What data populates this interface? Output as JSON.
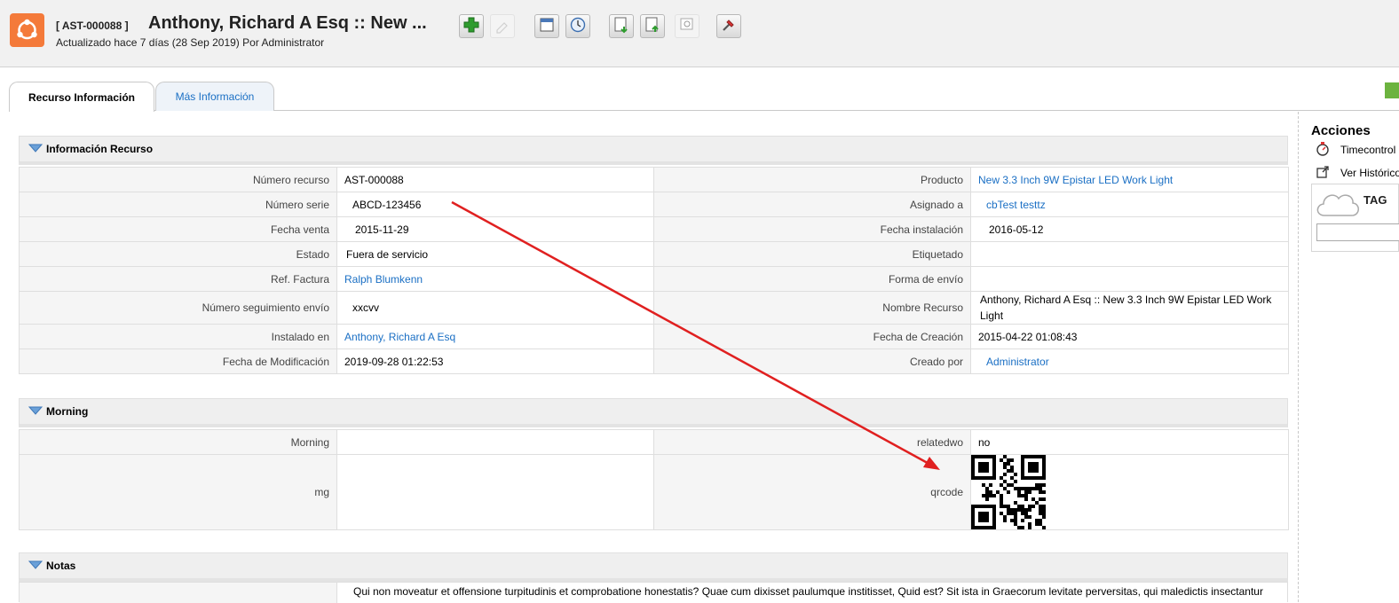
{
  "header": {
    "record_id": "[ AST-000088 ]",
    "title": "Anthony, Richard A Esq :: New ...",
    "subtitle": "Actualizado hace 7 días (28 Sep 2019) Por Administrator",
    "toolbar_icons": [
      "add-icon",
      "duplicate-icon",
      "calendar-icon",
      "clock-icon",
      "export-icon",
      "import-icon",
      "find-duplicates-icon",
      "settings-icon"
    ]
  },
  "tabs": [
    {
      "label": "Recurso Información",
      "active": true
    },
    {
      "label": "Más Información",
      "active": false
    }
  ],
  "sections": {
    "info": {
      "title": "Información Recurso",
      "rows": [
        {
          "l1": "Número recurso",
          "v1": "AST-000088",
          "l2": "Producto",
          "v2": "New 3.3 Inch 9W Epistar LED Work Light"
        },
        {
          "l1": "Número serie",
          "v1": "ABCD-123456",
          "l2": "Asignado a",
          "v2": "cbTest testtz"
        },
        {
          "l1": "Fecha venta",
          "v1": "2015-11-29",
          "l2": "Fecha instalación",
          "v2": "2016-05-12"
        },
        {
          "l1": "Estado",
          "v1": "Fuera de servicio",
          "l2": "Etiquetado",
          "v2": ""
        },
        {
          "l1": "Ref. Factura",
          "v1": "Ralph Blumkenn",
          "l2": "Forma de envío",
          "v2": ""
        },
        {
          "l1": "Número seguimiento envío",
          "v1": "xxcvv",
          "l2": "Nombre Recurso",
          "v2": "Anthony, Richard A Esq :: New 3.3 Inch 9W Epistar LED Work Light"
        },
        {
          "l1": "Instalado en",
          "v1": "Anthony, Richard A Esq",
          "l2": "Fecha de Creación",
          "v2": "2015-04-22 01:08:43"
        },
        {
          "l1": "Fecha de Modificación",
          "v1": "2019-09-28 01:22:53",
          "l2": "Creado por",
          "v2": "Administrator"
        }
      ]
    },
    "morning": {
      "title": "Morning",
      "rows": [
        {
          "l1": "Morning",
          "v1": "",
          "l2": "relatedwo",
          "v2": "no"
        },
        {
          "l1": "mg",
          "v1": "",
          "l2": "qrcode",
          "v2": ""
        }
      ]
    },
    "notas": {
      "title": "Notas",
      "text": "Qui non moveatur et offensione turpitudinis et comprobatione honestatis? Quae cum dixisset paulumque institisset, Quid est? Sit ista in Graecorum levitate perversitas, qui maledictis insectantur"
    }
  },
  "sidebar": {
    "title": "Acciones",
    "items": [
      {
        "label": "Timecontrol",
        "icon": "stopwatch-icon"
      },
      {
        "label": "Ver Histórico",
        "icon": "external-link-icon"
      }
    ],
    "tag_label": "TAG"
  },
  "colors": {
    "link": "#1a6fc4",
    "brand": "#f47a3a",
    "arrow": "#e02020"
  }
}
